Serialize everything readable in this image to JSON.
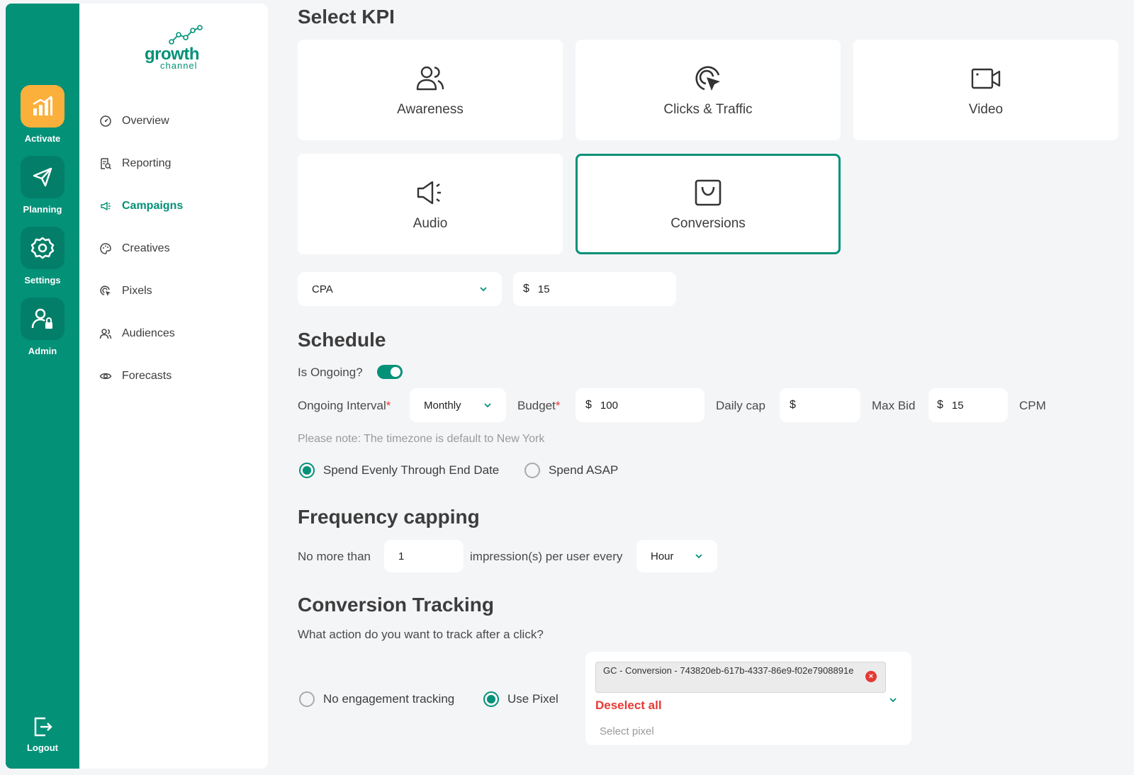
{
  "rail": {
    "activate": "Activate",
    "planning": "Planning",
    "settings": "Settings",
    "admin": "Admin",
    "logout": "Logout"
  },
  "logo": {
    "word": "growth",
    "sub": "channel"
  },
  "nav": {
    "overview": "Overview",
    "reporting": "Reporting",
    "campaigns": "Campaigns",
    "creatives": "Creatives",
    "pixels": "Pixels",
    "audiences": "Audiences",
    "forecasts": "Forecasts"
  },
  "kpi": {
    "title": "Select KPI",
    "awareness": "Awareness",
    "clicks": "Clicks & Traffic",
    "video": "Video",
    "audio": "Audio",
    "conversions": "Conversions",
    "metric": "CPA",
    "currency": "$",
    "value": "15"
  },
  "schedule": {
    "title": "Schedule",
    "ongoing_label": "Is Ongoing?",
    "interval_label": "Ongoing Interval",
    "interval_value": "Monthly",
    "budget_label": "Budget",
    "currency": "$",
    "budget_value": "100",
    "daily_cap_label": "Daily cap",
    "daily_cap_value": "",
    "max_bid_label": "Max Bid",
    "max_bid_value": "15",
    "cpm": "CPM",
    "note": "Please note: The timezone is default to New York",
    "spend_evenly": "Spend Evenly Through End Date",
    "spend_asap": "Spend ASAP",
    "required_mark": "*"
  },
  "frequency": {
    "title": "Frequency capping",
    "prefix": "No more than",
    "count": "1",
    "middle": "impression(s) per user every",
    "period": "Hour"
  },
  "conversion": {
    "title": "Conversion Tracking",
    "question": "What action do you want to track after a click?",
    "no_tracking": "No engagement tracking",
    "use_pixel": "Use Pixel",
    "chip": "GC - Conversion - 743820eb-617b-4337-86e9-f02e7908891e",
    "chip_remove": "×",
    "deselect": "Deselect all",
    "placeholder": "Select pixel"
  },
  "colors": {
    "primary": "#039178",
    "accent": "#fbb03b",
    "danger": "#e53935"
  }
}
